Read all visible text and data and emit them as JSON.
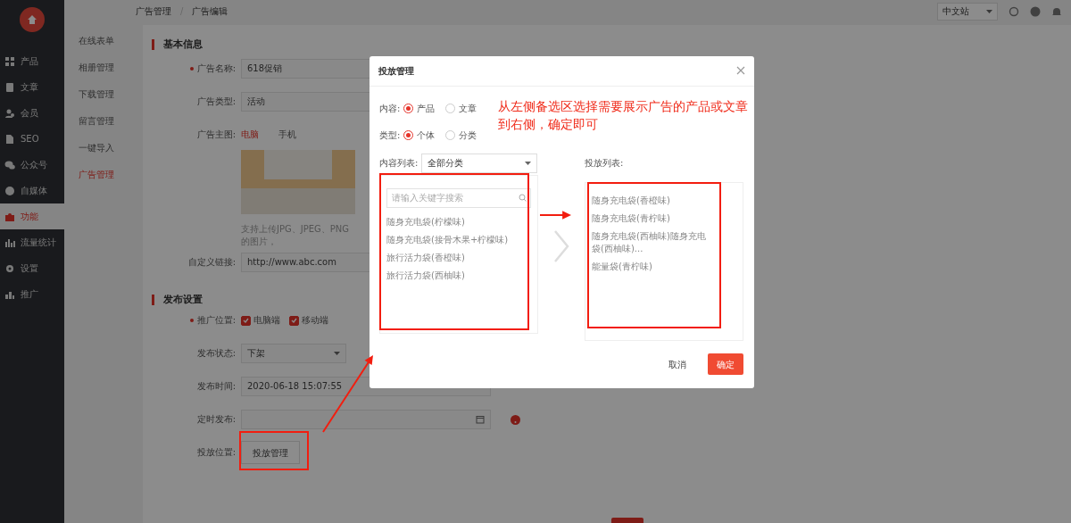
{
  "sidebar": {
    "items": [
      {
        "label": "产品",
        "selected": false
      },
      {
        "label": "文章",
        "selected": false
      },
      {
        "label": "会员",
        "selected": false
      },
      {
        "label": "SEO",
        "selected": false
      },
      {
        "label": "公众号",
        "selected": false
      },
      {
        "label": "自媒体",
        "selected": false
      },
      {
        "label": "功能",
        "selected": true
      },
      {
        "label": "流量统计",
        "selected": false
      },
      {
        "label": "设置",
        "selected": false
      },
      {
        "label": "推广",
        "selected": false
      }
    ]
  },
  "subnav": [
    {
      "label": "在线表单",
      "selected": false
    },
    {
      "label": "相册管理",
      "selected": false
    },
    {
      "label": "下载管理",
      "selected": false
    },
    {
      "label": "留言管理",
      "selected": false
    },
    {
      "label": "一键导入",
      "selected": false
    },
    {
      "label": "广告管理",
      "selected": true
    }
  ],
  "breadcrumb": {
    "items": [
      "广告管理",
      "广告编辑"
    ],
    "separator": "/"
  },
  "topbar": {
    "language": "中文站"
  },
  "sections": [
    {
      "title": "基本信息",
      "rows": [
        {
          "kind": "input",
          "label": "广告名称:",
          "required": true,
          "value": "618促销"
        },
        {
          "kind": "input",
          "label": "广告类型:",
          "required": false,
          "value": "活动"
        },
        {
          "kind": "image",
          "label": "广告主图:",
          "required": false,
          "tabs": [
            {
              "label": "电脑",
              "selected": true
            },
            {
              "label": "手机",
              "selected": false
            }
          ],
          "hint": "支持上传JPG、JPEG、PNG的图片，"
        },
        {
          "kind": "input",
          "label": "自定义链接:",
          "required": false,
          "value": "http://www.abc.com"
        }
      ]
    },
    {
      "title": "发布设置",
      "rows": [
        {
          "kind": "checks",
          "label": "推广位置:",
          "required": true,
          "options": [
            {
              "label": "电脑端",
              "checked": true
            },
            {
              "label": "移动端",
              "checked": true
            }
          ]
        },
        {
          "kind": "select",
          "label": "发布状态:",
          "required": false,
          "value": "下架"
        },
        {
          "kind": "input",
          "label": "发布时间:",
          "required": false,
          "value": "2020-06-18 15:07:55"
        },
        {
          "kind": "date",
          "label": "定时发布:",
          "required": false
        },
        {
          "kind": "button",
          "label": "投放位置:",
          "required": false,
          "button": "投放管理"
        }
      ]
    }
  ],
  "dialog": {
    "title": "投放管理",
    "radios": [
      {
        "label": "内容:",
        "options": [
          {
            "label": "产品",
            "selected": true
          },
          {
            "label": "文章",
            "selected": false
          }
        ]
      },
      {
        "label": "类型:",
        "options": [
          {
            "label": "个体",
            "selected": true
          },
          {
            "label": "分类",
            "selected": false
          }
        ]
      }
    ],
    "annotation": "从左侧备选区选择需要展示广告的产品或文章到右侧，确定即可",
    "source_label": "内容列表:",
    "category": "全部分类",
    "search": {
      "placeholder": "请输入关键字搜索"
    },
    "source_items": [
      "随身充电袋(柠檬味)",
      "随身充电袋(接骨木果+柠檬味)",
      "旅行活力袋(香橙味)",
      "旅行活力袋(西柚味)"
    ],
    "target_label": "投放列表:",
    "target_items": [
      "随身充电袋(香橙味)",
      "随身充电袋(青柠味)",
      "随身充电袋(西柚味)随身充电袋(西柚味)...",
      "能量袋(青柠味)"
    ],
    "buttons": {
      "cancel": "取消",
      "ok": "确定"
    }
  }
}
